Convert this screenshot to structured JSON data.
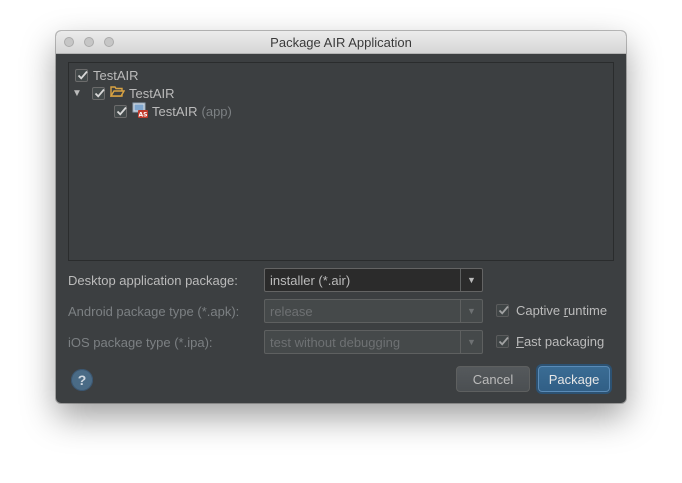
{
  "window": {
    "title": "Package AIR Application"
  },
  "tree": {
    "root": {
      "label": "TestAIR",
      "checked": true
    },
    "module": {
      "label": "TestAIR",
      "checked": true,
      "expanded": true
    },
    "app": {
      "label": "TestAIR",
      "suffix": "(app)",
      "checked": true,
      "icon_badge": "AS"
    }
  },
  "form": {
    "desktop": {
      "label": "Desktop application package:",
      "value": "installer (*.air)"
    },
    "android": {
      "label": "Android package type (*.apk):",
      "value": "release"
    },
    "ios": {
      "label": "iOS package type (*.ipa):",
      "value": "test without debugging"
    }
  },
  "options": {
    "captive": {
      "label_pre": "Captive ",
      "label_mnemonic": "r",
      "label_post": "untime",
      "checked": true
    },
    "fast": {
      "label_pre": "",
      "label_mnemonic": "F",
      "label_post": "ast packaging",
      "checked": true
    }
  },
  "buttons": {
    "help": "?",
    "cancel": "Cancel",
    "package": "Package"
  },
  "colors": {
    "window_bg": "#3c3f41",
    "primary_button": "#365f86",
    "help_icon": "#4a6b86"
  }
}
